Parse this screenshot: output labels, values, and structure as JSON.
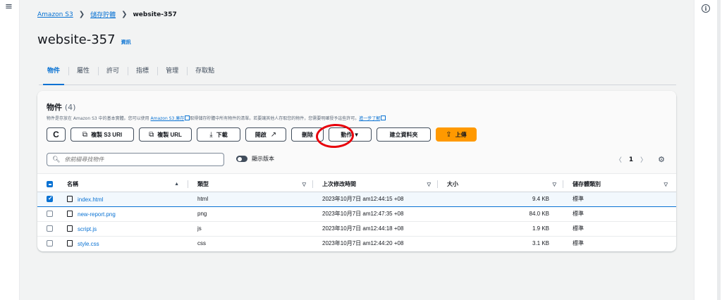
{
  "app": {
    "menu_icon": "hamburger-icon",
    "info_icon": "info-icon"
  },
  "breadcrumb": {
    "items": [
      "Amazon S3",
      "儲存貯體",
      "website-357"
    ]
  },
  "page": {
    "title": "website-357",
    "info_label": "資訊"
  },
  "tabs": [
    "物件",
    "屬性",
    "許可",
    "指標",
    "管理",
    "存取點"
  ],
  "objects": {
    "heading": "物件",
    "count": "(4)",
    "description_pre": "物件是存放在 Amazon S3 中的基本實體。您可以使用 ",
    "description_link1": "Amazon S3 庫存",
    "description_mid": "取得儲存貯體中所有物件的清單。若要讓其他人存取您的物件，您需要明確授予這些許可。",
    "description_link2": "進一步了解",
    "toolbar": {
      "refresh": "C",
      "copy_s3_uri": "複製 S3 URI",
      "copy_url": "複製 URL",
      "download": "下載",
      "open": "開啟",
      "delete": "刪除",
      "actions": "動作 ▼",
      "create_folder": "建立資料夾",
      "upload": "上傳"
    },
    "search_placeholder": "依前綴尋找物件",
    "show_versions": "顯示版本",
    "page_number": "1",
    "columns": [
      "名稱",
      "類型",
      "上次修改時間",
      "大小",
      "儲存體類別"
    ],
    "rows": [
      {
        "name": "index.html",
        "type": "html",
        "modified": "2023年10月7日 am12:44:15 +08",
        "size": "9.4 KB",
        "storage": "標準",
        "selected": true
      },
      {
        "name": "new-report.png",
        "type": "png",
        "modified": "2023年10月7日 am12:47:35 +08",
        "size": "84.0 KB",
        "storage": "標準",
        "selected": false
      },
      {
        "name": "script.js",
        "type": "js",
        "modified": "2023年10月7日 am12:44:18 +08",
        "size": "1.9 KB",
        "storage": "標準",
        "selected": false
      },
      {
        "name": "style.css",
        "type": "css",
        "modified": "2023年10月7日 am12:44:20 +08",
        "size": "3.1 KB",
        "storage": "標準",
        "selected": false
      }
    ]
  },
  "colors": {
    "link": "#0972d3",
    "primary_button": "#ff9900",
    "annotation": "#e8000b"
  }
}
